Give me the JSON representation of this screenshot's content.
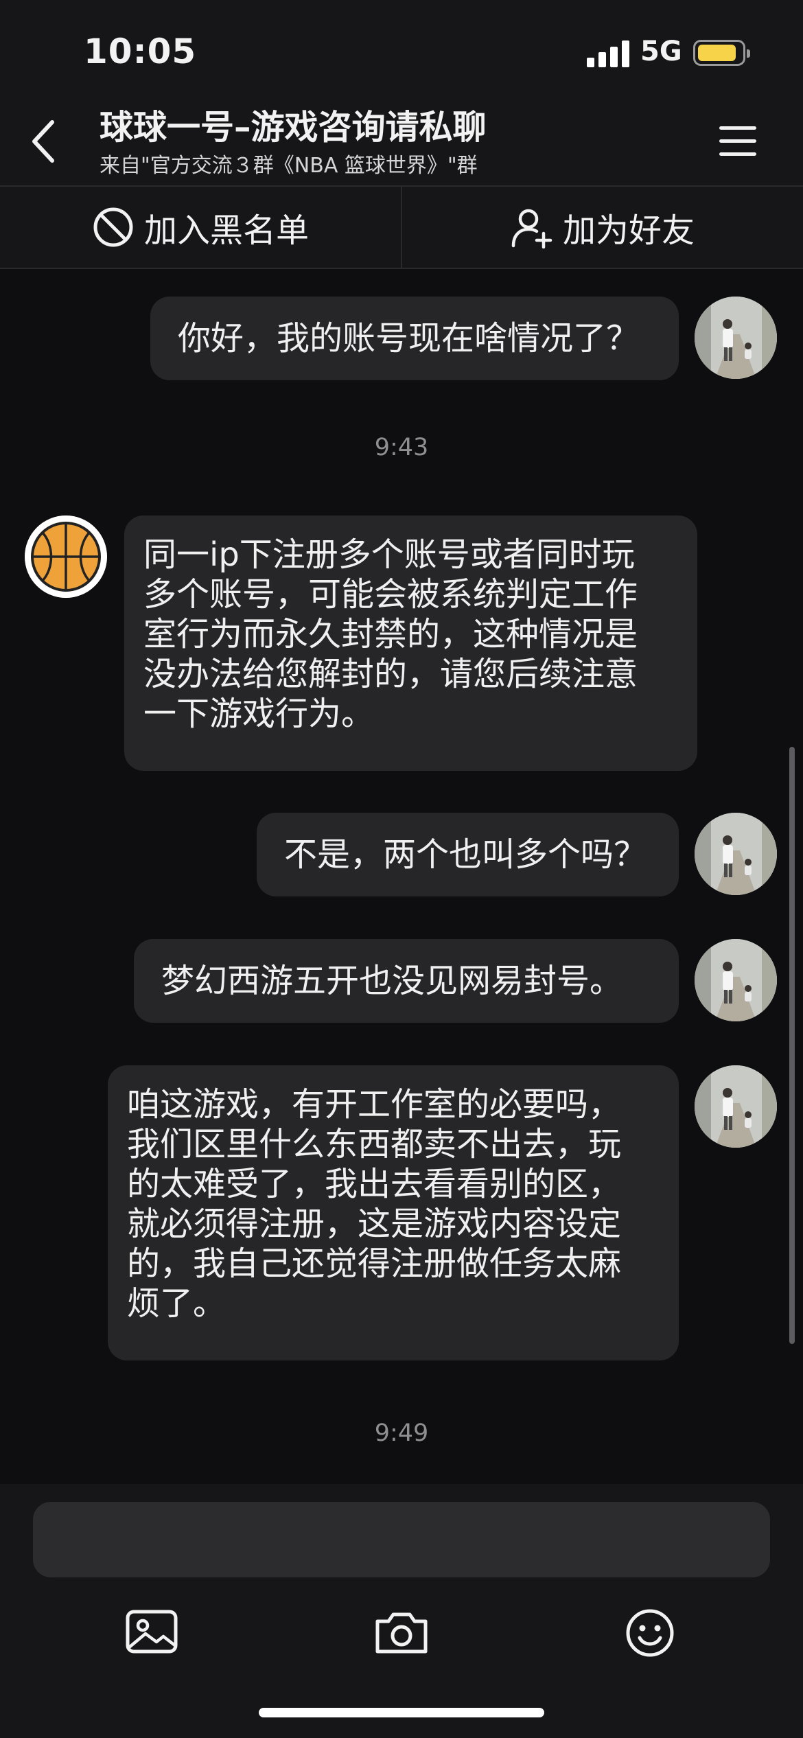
{
  "status_bar": {
    "time": "10:05",
    "network": "5G",
    "battery_level": 0.78,
    "battery_color": "#f7d34a"
  },
  "header": {
    "title": "球球一号–游戏咨询请私聊",
    "subtitle": "来自\"官方交流３群《NBA 篮球世界》\"群",
    "back_icon": "chevron-left-icon",
    "menu_icon": "hamburger-menu-icon"
  },
  "actions": {
    "block": {
      "label": "加入黑名单",
      "icon": "block-icon"
    },
    "add_friend": {
      "label": "加为好友",
      "icon": "add-person-icon"
    }
  },
  "messages": [
    {
      "sender": "me",
      "lines": [
        "你好，我的账号现在啥情况了？"
      ]
    },
    {
      "type": "timestamp",
      "text": "9:43"
    },
    {
      "sender": "support",
      "lines": [
        "同一ip下注册多个账号或者同时玩",
        "多个账号，可能会被系统判定工作",
        "室行为而永久封禁的，这种情况是",
        "没办法给您解封的，请您后续注意",
        "一下游戏行为。"
      ]
    },
    {
      "sender": "me",
      "lines": [
        "不是，两个也叫多个吗？"
      ]
    },
    {
      "sender": "me",
      "lines": [
        "梦幻西游五开也没见网易封号。"
      ]
    },
    {
      "sender": "me",
      "lines": [
        "咱这游戏，有开工作室的必要吗，",
        "我们区里什么东西都卖不出去，玩",
        "的太难受了，我出去看看别的区，",
        "就必须得注册，这是游戏内容设定",
        "的，我自己还觉得注册做任务太麻",
        "烦了。"
      ]
    },
    {
      "type": "timestamp",
      "text": "9:49"
    }
  ],
  "composer": {
    "input_value": "",
    "tools": [
      "image-icon",
      "camera-icon",
      "emoji-icon"
    ]
  },
  "colors": {
    "background": "#0e0e10",
    "bar": "#161618",
    "bubble": "#262628",
    "timestamp": "#8e8e93"
  }
}
